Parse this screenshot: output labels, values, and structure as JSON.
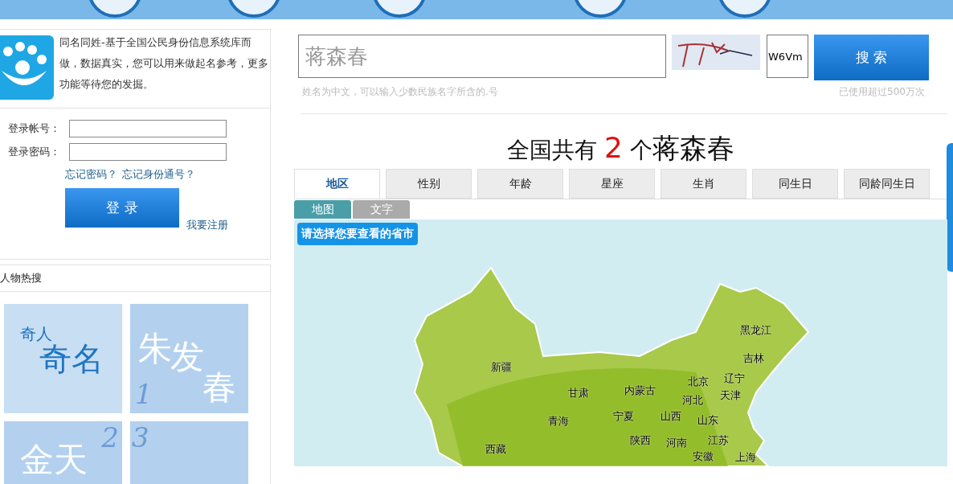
{
  "intro": {
    "text": "同名同姓-基于全国公民身份信息系统库而做，数据真实，您可以用来做起名参考，更多功能等待您的发掘。"
  },
  "login": {
    "account_label": "登录帐号：",
    "password_label": "登录密码：",
    "links": [
      "忘记密码？",
      "忘记身份通号？"
    ],
    "button": "登 录",
    "register_link": "我要注册"
  },
  "hot": {
    "title": "人物热搜",
    "tiles": [
      {
        "kind": "feature",
        "lines": [
          "奇人",
          "奇名"
        ]
      },
      {
        "kind": "ranked",
        "lines": [
          "朱",
          "发",
          "春"
        ],
        "rank": "1"
      },
      {
        "kind": "ranked",
        "lines": [
          "金天"
        ],
        "rank": "2"
      },
      {
        "kind": "ranked",
        "rank": "3"
      }
    ]
  },
  "search": {
    "value": "蒋森春",
    "hint": "姓名为中文，可以输入少数民族名字所含的.号",
    "captcha_value": "W6Vm",
    "button": "搜 索",
    "usage": "已使用超过500万次"
  },
  "result": {
    "prefix": "全国共有",
    "count": "2",
    "unit": "个",
    "name": "蒋森春"
  },
  "tabs": [
    {
      "label": "地区",
      "selected": true
    },
    {
      "label": "性别",
      "selected": false
    },
    {
      "label": "年龄",
      "selected": false
    },
    {
      "label": "星座",
      "selected": false
    },
    {
      "label": "生肖",
      "selected": false
    },
    {
      "label": "同生日",
      "selected": false
    },
    {
      "label": "同龄同生日",
      "selected": false
    }
  ],
  "view_tabs": [
    {
      "label": "地图",
      "selected": true
    },
    {
      "label": "文字",
      "selected": false
    }
  ],
  "map": {
    "prompt": "请选择您要查看的省市",
    "provinces": [
      {
        "name": "新疆"
      },
      {
        "name": "甘肃"
      },
      {
        "name": "内蒙古"
      },
      {
        "name": "北京"
      },
      {
        "name": "辽宁"
      },
      {
        "name": "黑龙江"
      },
      {
        "name": "吉林"
      },
      {
        "name": "河北"
      },
      {
        "name": "天津"
      },
      {
        "name": "青海"
      },
      {
        "name": "宁夏"
      },
      {
        "name": "山西"
      },
      {
        "name": "山东"
      },
      {
        "name": "陕西"
      },
      {
        "name": "河南"
      },
      {
        "name": "江苏"
      },
      {
        "name": "西藏"
      },
      {
        "name": "安徽"
      },
      {
        "name": "上海"
      }
    ]
  }
}
